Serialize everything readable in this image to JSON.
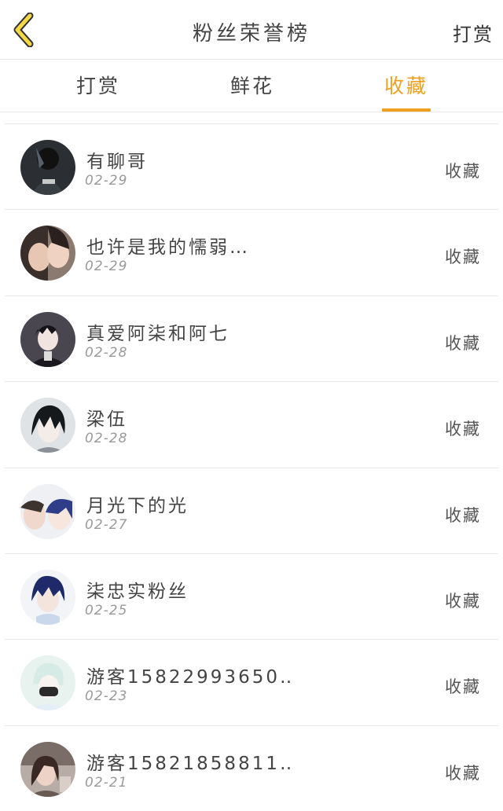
{
  "header": {
    "title": "粉丝荣誉榜",
    "right_label": "打赏",
    "back_icon": "chevron-left-icon",
    "accent_color": "#f0a020"
  },
  "tabs": [
    {
      "label": "打赏",
      "active": false
    },
    {
      "label": "鲜花",
      "active": false
    },
    {
      "label": "收藏",
      "active": true
    }
  ],
  "list": [
    {
      "name": "有聊哥",
      "date": "02-29",
      "action": "收藏",
      "avatar": "dark-anime-avatar"
    },
    {
      "name": "也许是我的懦弱…",
      "date": "02-29",
      "action": "收藏",
      "avatar": "couple-photo-avatar"
    },
    {
      "name": "真爱阿柒和阿七",
      "date": "02-28",
      "action": "收藏",
      "avatar": "dark-hair-boy-avatar"
    },
    {
      "name": "梁伍",
      "date": "02-28",
      "action": "收藏",
      "avatar": "black-hair-anime-avatar"
    },
    {
      "name": "月光下的光",
      "date": "02-27",
      "action": "收藏",
      "avatar": "two-faces-anime-avatar"
    },
    {
      "name": "柒忠实粉丝",
      "date": "02-25",
      "action": "收藏",
      "avatar": "blue-hair-anime-avatar"
    },
    {
      "name": "游客15822993650…",
      "date": "02-23",
      "action": "收藏",
      "avatar": "masked-boy-avatar"
    },
    {
      "name": "游客15821858811…",
      "date": "02-21",
      "action": "收藏",
      "avatar": "girl-photo-avatar"
    }
  ]
}
